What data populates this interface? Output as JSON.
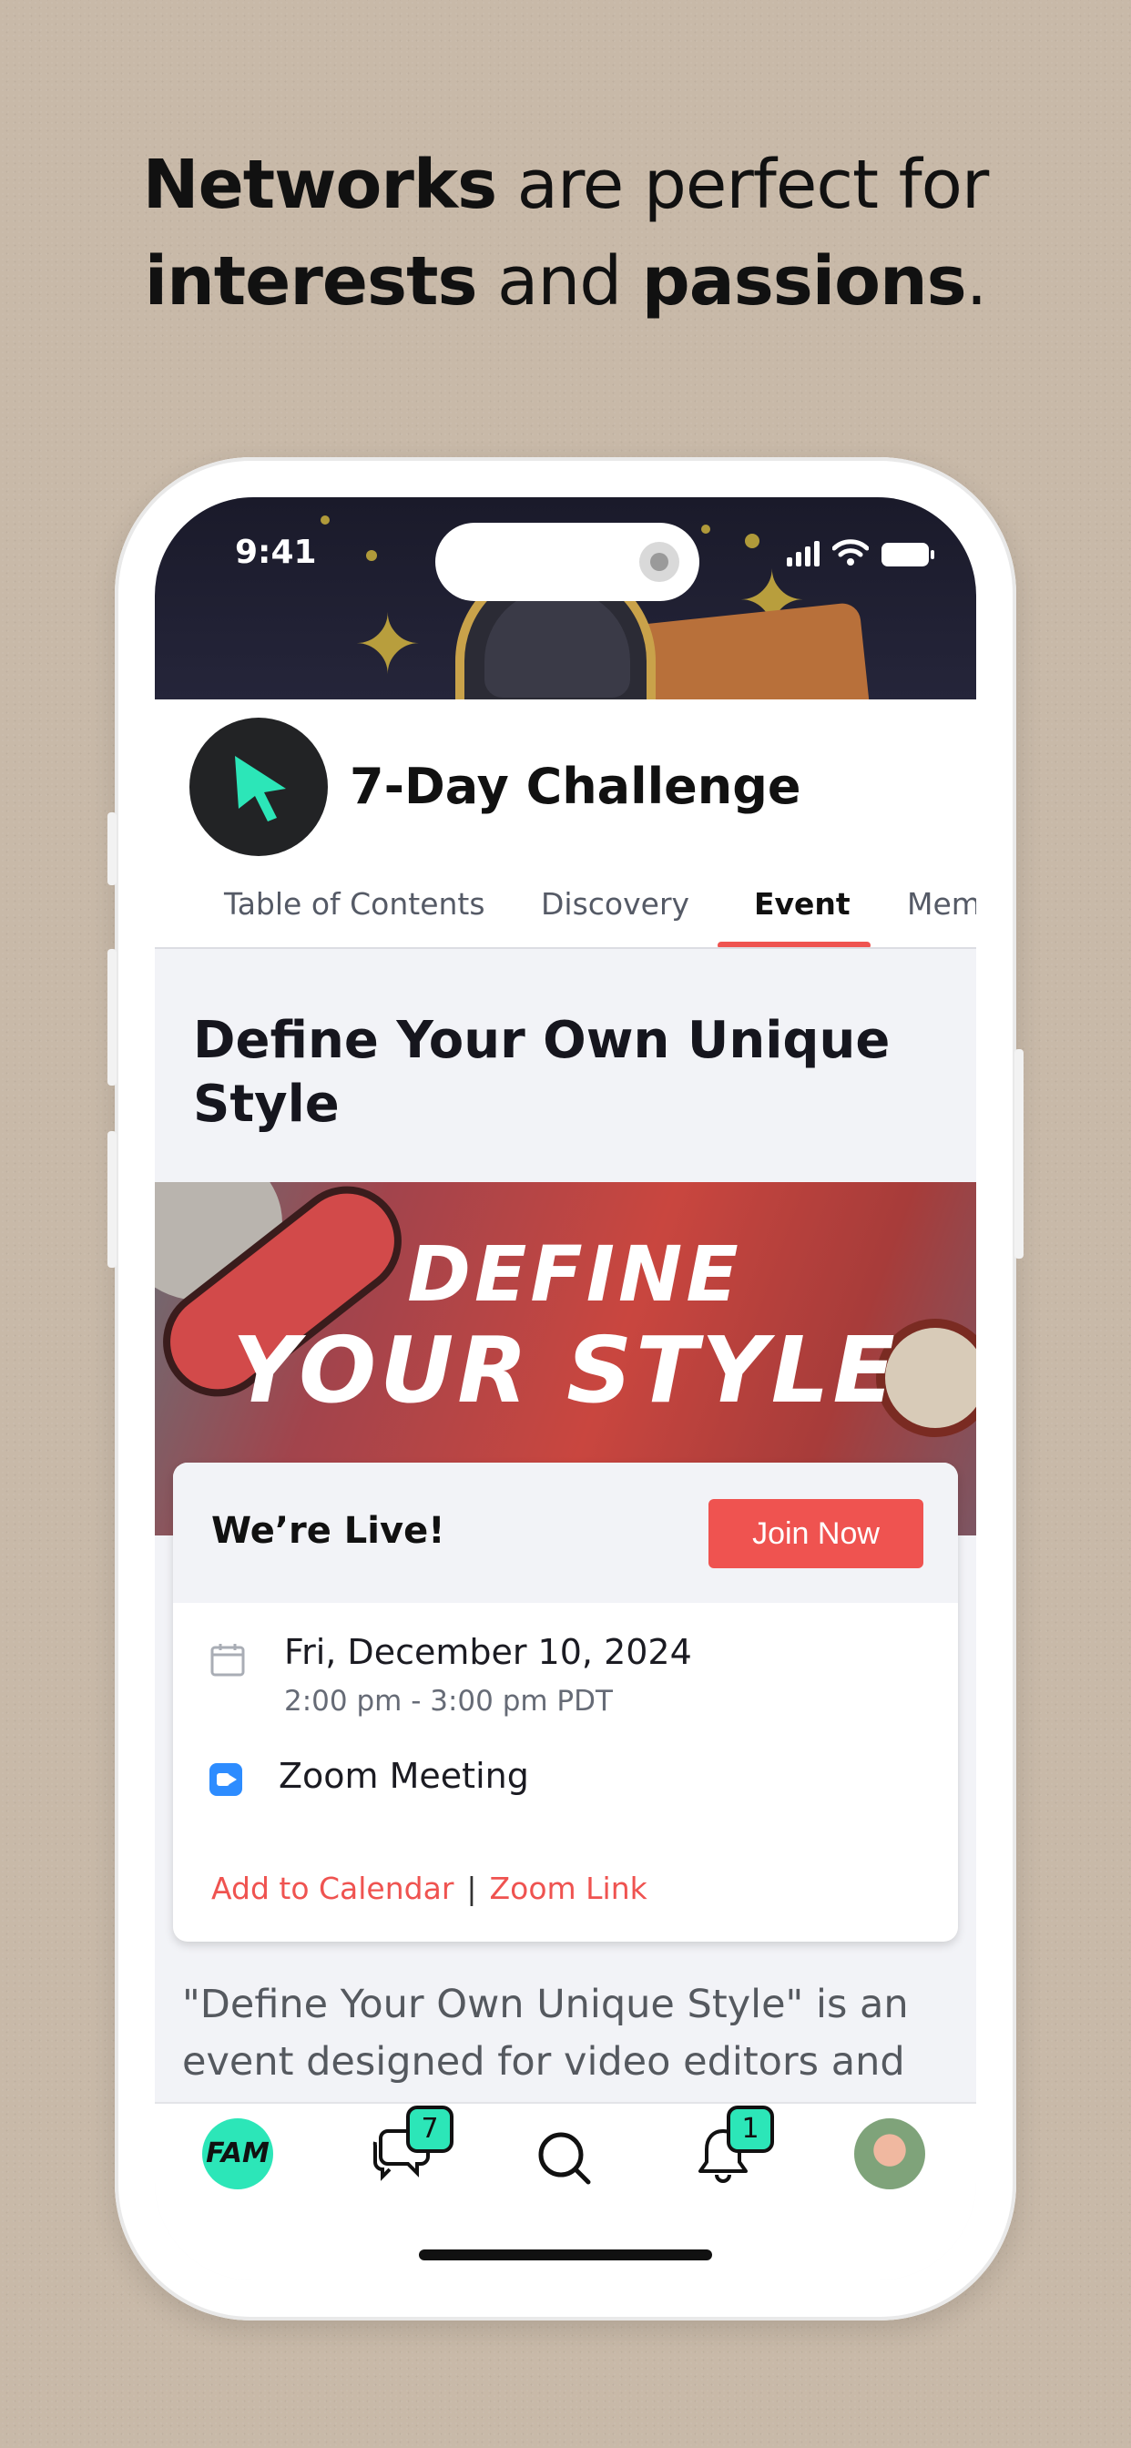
{
  "headline": {
    "line1_bold": "Networks",
    "line1_rest": " are perfect for",
    "line2_bold1": "interests",
    "line2_mid": " and ",
    "line2_bold2": "passions",
    "line2_end": "."
  },
  "status_bar": {
    "time": "9:41"
  },
  "group": {
    "title": "7-Day Challenge",
    "tabs": [
      "Table of Contents",
      "Discovery",
      "Event",
      "Mem"
    ],
    "active_tab": "Event"
  },
  "event": {
    "title": "Define Your Own Unique Style",
    "banner_line1": "DEFINE",
    "banner_line2": "YOUR STYLE",
    "live_label": "We’re Live!",
    "join_label": "Join Now",
    "date": "Fri, December 10, 2024",
    "time": "2:00 pm - 3:00 pm PDT",
    "location": "Zoom Meeting",
    "link_calendar": "Add to Calendar",
    "link_separator": "|",
    "link_zoom": "Zoom Link",
    "description": "\"Define Your Own Unique Style\" is an event designed for video editors and"
  },
  "bottom_nav": {
    "logo_text": "FAM",
    "messages_badge": "7",
    "notifications_badge": "1",
    "icons": [
      "fam-logo",
      "chat-icon",
      "search-icon",
      "bell-icon",
      "profile-avatar"
    ]
  },
  "colors": {
    "accent": "#ef5350",
    "brand_teal": "#2ce6b8",
    "background": "#c8b9a8"
  }
}
